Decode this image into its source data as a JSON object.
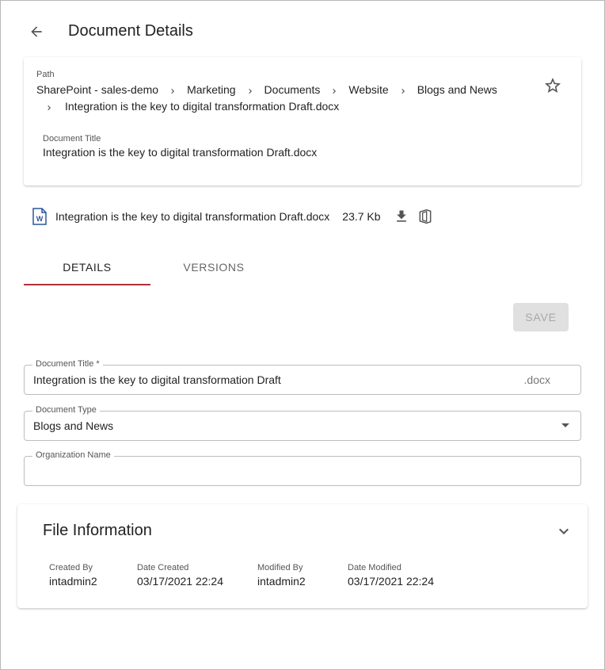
{
  "header": {
    "title": "Document Details"
  },
  "path": {
    "label": "Path",
    "crumbs": [
      "SharePoint - sales-demo",
      "Marketing",
      "Documents",
      "Website",
      "Blogs and News"
    ],
    "last_crumb": "Integration is the key to digital transformation Draft.docx"
  },
  "summary": {
    "doc_title_label": "Document Title",
    "doc_title_value": "Integration is the key to digital transformation Draft.docx"
  },
  "file": {
    "name": "Integration is the key to digital transformation Draft.docx",
    "size": "23.7 Kb"
  },
  "tabs": [
    {
      "label": "DETAILS",
      "active": true
    },
    {
      "label": "VERSIONS",
      "active": false
    }
  ],
  "save_label": "SAVE",
  "form": {
    "title_label": "Document Title *",
    "title_value": "Integration is the key to digital transformation Draft",
    "title_suffix": ".docx",
    "type_label": "Document Type",
    "type_value": "Blogs and News",
    "org_label": "Organization Name",
    "org_value": ""
  },
  "file_info": {
    "title": "File Information",
    "created_by_label": "Created By",
    "created_by": "intadmin2",
    "date_created_label": "Date Created",
    "date_created": "03/17/2021 22:24",
    "modified_by_label": "Modified By",
    "modified_by": "intadmin2",
    "date_modified_label": "Date Modified",
    "date_modified": "03/17/2021 22:24"
  },
  "colors": {
    "accent": "#b0313a",
    "word_blue": "#2b579a"
  }
}
